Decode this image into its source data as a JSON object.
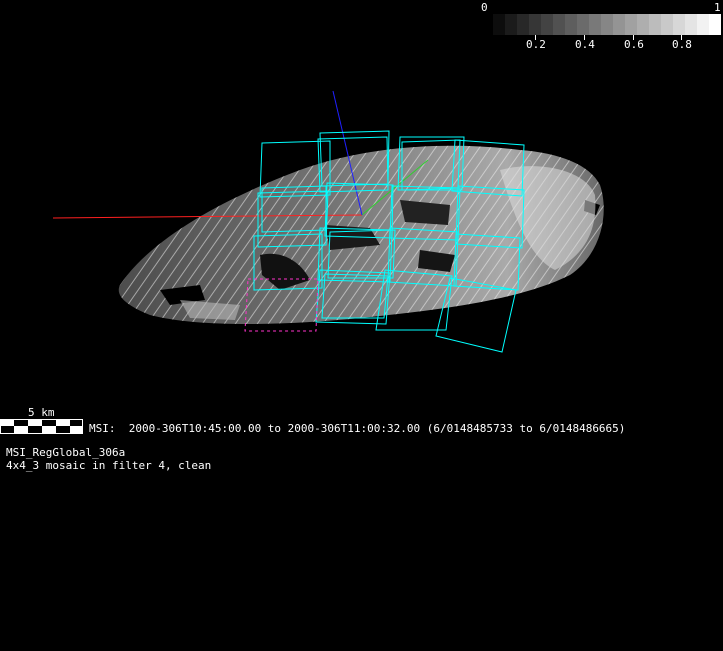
{
  "colorbar": {
    "min_label": "0",
    "max_label": "1",
    "ticks": [
      "0.2",
      "0.4",
      "0.6",
      "0.8"
    ]
  },
  "scale_bar": {
    "label": "5 km"
  },
  "info": {
    "time_line": "MSI:  2000-306T10:45:00.00 to 2000-306T11:00:32.00 (6/0148485733 to 6/0148486665)",
    "name_line": "MSI_RegGlobal_306a",
    "desc_line": "4x4_3 mosaic in filter 4, clean"
  },
  "colors": {
    "footprint": "#00ffff",
    "highlight_footprint": "#ff33cc",
    "axis_x": "#ff2020",
    "axis_y": "#30d030",
    "axis_z": "#2020ff"
  }
}
